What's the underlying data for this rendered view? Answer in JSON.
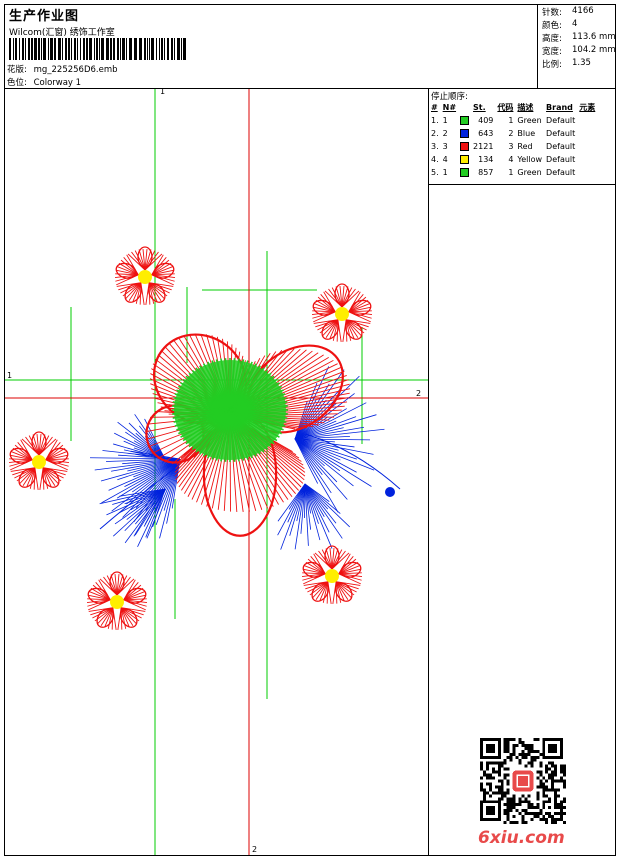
{
  "header": {
    "title": "生产作业图",
    "company": "Wilcom(汇窗) 绣饰工作室",
    "design_label": "花版:",
    "design_value": "mg_225256D6.emb",
    "colorway_label": "色位:",
    "colorway_value": "Colorway 1"
  },
  "stats": [
    {
      "label": "针数:",
      "value": "4166"
    },
    {
      "label": "颜色:",
      "value": "4"
    },
    {
      "label": "高度:",
      "value": "113.6 mm"
    },
    {
      "label": "宽度:",
      "value": "104.2 mm"
    },
    {
      "label": "比例:",
      "value": "1.35"
    }
  ],
  "stop_sequence": {
    "title": "停止顺序:",
    "columns": [
      "#",
      "N#",
      "St.",
      "代码",
      "描述",
      "Brand",
      "元素"
    ],
    "rows": [
      {
        "num": "1.",
        "n": "1",
        "color": "#22cc22",
        "st": "409",
        "code": "1",
        "desc": "Green",
        "brand": "Default"
      },
      {
        "num": "2.",
        "n": "2",
        "color": "#0022dd",
        "st": "643",
        "code": "2",
        "desc": "Blue",
        "brand": "Default"
      },
      {
        "num": "3.",
        "n": "3",
        "color": "#ee1111",
        "st": "2121",
        "code": "3",
        "desc": "Red",
        "brand": "Default"
      },
      {
        "num": "4.",
        "n": "4",
        "color": "#ffee00",
        "st": "134",
        "code": "4",
        "desc": "Yellow",
        "brand": "Default"
      },
      {
        "num": "5.",
        "n": "1",
        "color": "#22cc22",
        "st": "857",
        "code": "1",
        "desc": "Green",
        "brand": "Default"
      }
    ]
  },
  "axes": {
    "green_top": "1",
    "green_left": "1",
    "red_right": "2",
    "red_bottom": "2"
  },
  "colors": {
    "green": "#22cc22",
    "blue": "#0022dd",
    "red": "#ee1111",
    "yellow": "#ffee00",
    "axis_red": "#dd0000",
    "axis_green": "#00cc00"
  },
  "watermark": "6xiu.com"
}
